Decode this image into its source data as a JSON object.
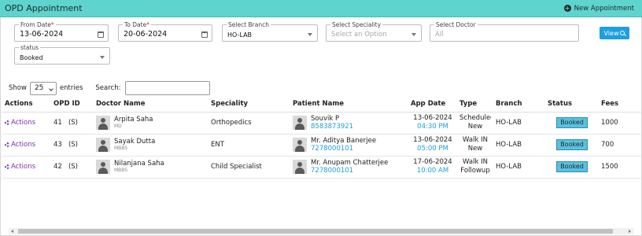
{
  "header": {
    "title": "OPD Appointment",
    "new_appointment_label": "New Appointment"
  },
  "filters": {
    "from_date": {
      "label": "From Date",
      "value": "13-06-2024"
    },
    "to_date": {
      "label": "To Date",
      "value": "20-06-2024"
    },
    "branch": {
      "label": "Select Branch",
      "value": "HO-LAB"
    },
    "speciality": {
      "label": "Select Speciality",
      "placeholder": "Select an Option"
    },
    "doctor": {
      "label": "Select Doctor",
      "placeholder": "All"
    },
    "status": {
      "label": "status",
      "value": "Booked"
    },
    "view_button_label": "View"
  },
  "table_controls": {
    "show_label": "Show",
    "entries_value": "25",
    "entries_label": "entries",
    "search_label": "Search:",
    "search_value": ""
  },
  "columns": [
    "Actions",
    "OPD ID",
    "Doctor Name",
    "Speciality",
    "Patient Name",
    "App Date",
    "Type",
    "Branch",
    "Status",
    "Fees"
  ],
  "rows": [
    {
      "action": "Actions",
      "opd_id": "41",
      "opd_suffix": "(S)",
      "doctor_name": "Arpita Saha",
      "doctor_degree": "MD",
      "speciality": "Orthopedics",
      "patient_name": "Souvik P",
      "patient_phone": "8583873921",
      "app_date": "13-06-2024",
      "app_time": "04:30 PM",
      "type_line1": "Scheduled",
      "type_line2": "New",
      "branch": "HO-LAB",
      "status": "Booked",
      "fees": "1000"
    },
    {
      "action": "Actions",
      "opd_id": "43",
      "opd_suffix": "(S)",
      "doctor_name": "Sayak Dutta",
      "doctor_degree": "MBBS",
      "speciality": "ENT",
      "patient_name": "Mr. Aditya Banerjee",
      "patient_phone": "7278000101",
      "app_date": "13-06-2024",
      "app_time": "05:00 PM",
      "type_line1": "Walk IN",
      "type_line2": "New",
      "branch": "HO-LAB",
      "status": "Booked",
      "fees": "700"
    },
    {
      "action": "Actions",
      "opd_id": "42",
      "opd_suffix": "(S)",
      "doctor_name": "Nilanjana Saha",
      "doctor_degree": "MBBS",
      "speciality": "Child Specialist",
      "patient_name": "Mr. Anupam Chatterjee",
      "patient_phone": "7278000101",
      "app_date": "17-06-2024",
      "app_time": "10:00 AM",
      "type_line1": "Walk IN",
      "type_line2": "Followup",
      "branch": "HO-LAB",
      "status": "Booked",
      "fees": "1500"
    }
  ],
  "colors": {
    "header_bg": "#5fd3cd",
    "accent_blue": "#1e9fe0",
    "action_purple": "#7b2fa8",
    "badge_bg": "#5bc0de"
  }
}
